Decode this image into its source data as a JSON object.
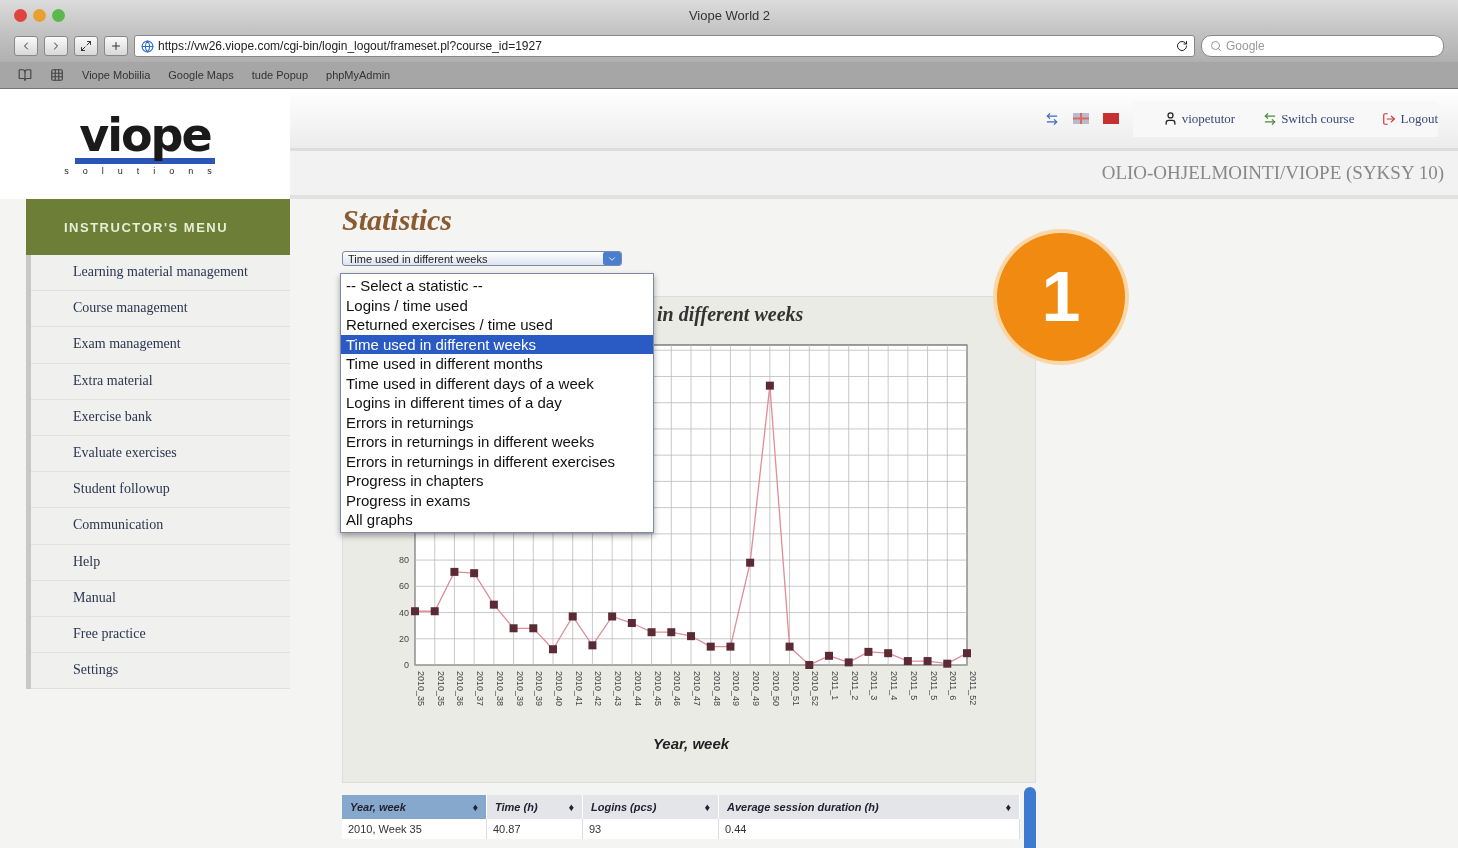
{
  "browser": {
    "title": "Viope World 2",
    "url": "https://vw26.viope.com/cgi-bin/login_logout/frameset.pl?course_id=1927",
    "search_placeholder": "Google",
    "bookmarks": [
      "Viope Mobiilia",
      "Google Maps",
      "tude Popup",
      "phpMyAdmin"
    ]
  },
  "logo": {
    "name": "viope",
    "tagline": "solutions"
  },
  "header": {
    "user": "viopetutor",
    "links": [
      {
        "kind": "switch",
        "label": "Switch course"
      },
      {
        "kind": "logout",
        "label": "Logout"
      }
    ],
    "course": "OLIO-OHJELMOINTI/VIOPE (SYKSY 10)"
  },
  "menu": {
    "title": "INSTRUCTOR'S MENU",
    "items": [
      "Learning material management",
      "Course management",
      "Exam management",
      "Extra material",
      "Exercise bank",
      "Evaluate exercises",
      "Student followup",
      "Communication",
      "Help",
      "Manual",
      "Free practice",
      "Settings"
    ]
  },
  "page": {
    "title": "Statistics",
    "select": {
      "value": "Time used in different weeks",
      "options": [
        {
          "label": "-- Select a statistic --",
          "selected": false
        },
        {
          "label": "Logins / time used",
          "selected": false
        },
        {
          "label": "Returned exercises / time used",
          "selected": false
        },
        {
          "label": "Time used in different weeks",
          "selected": true
        },
        {
          "label": "Time used in different months",
          "selected": false
        },
        {
          "label": "Time used in different days of a week",
          "selected": false
        },
        {
          "label": "Logins in different times of a day",
          "selected": false
        },
        {
          "label": "Errors in returnings",
          "selected": false
        },
        {
          "label": "Errors in returnings in different weeks",
          "selected": false
        },
        {
          "label": "Errors in returnings in different exercises",
          "selected": false
        },
        {
          "label": "Progress in chapters",
          "selected": false
        },
        {
          "label": "Progress in exams",
          "selected": false
        },
        {
          "label": "All graphs",
          "selected": false
        }
      ]
    }
  },
  "callout": "1",
  "chart": {
    "chart_data": {
      "type": "line",
      "title": "in different weeks",
      "xlabel": "Year, week",
      "categories": [
        "2010_35",
        "2010_35",
        "2010_36",
        "2010_37",
        "2010_38",
        "2010_39",
        "2010_39",
        "2010_40",
        "2010_41",
        "2010_42",
        "2010_43",
        "2010_44",
        "2010_45",
        "2010_46",
        "2010_47",
        "2010_48",
        "2010_49",
        "2010_49",
        "2010_50",
        "2010_51",
        "2010_52",
        "2011_1",
        "2011_2",
        "2011_3",
        "2011_4",
        "2011_5",
        "2011_5",
        "2011_6",
        "2011_52"
      ],
      "grid": true,
      "series": [
        {
          "color": "#e08c9a",
          "marker": "square",
          "values": [
            41,
            41,
            71,
            70,
            46,
            28,
            28,
            12,
            37,
            15,
            37,
            32,
            25,
            25,
            22,
            14,
            14,
            78,
            213,
            14,
            0,
            7,
            2,
            10,
            9,
            3,
            3,
            1,
            9
          ]
        }
      ],
      "ylim": [
        0,
        244
      ],
      "yticks": [
        0,
        20,
        40,
        60,
        80
      ]
    }
  },
  "table": {
    "columns": [
      {
        "label": "Year, week",
        "sorted": true,
        "sort_glyph": "♦"
      },
      {
        "label": "Time (h)",
        "sorted": false,
        "sort_glyph": "♦"
      },
      {
        "label": "Logins (pcs)",
        "sorted": false,
        "sort_glyph": "♦"
      },
      {
        "label": "Average session duration (h)",
        "sorted": false,
        "sort_glyph": "♦"
      }
    ],
    "rows": [
      [
        "2010, Week 35",
        "40.87",
        "93",
        "0.44"
      ]
    ]
  }
}
